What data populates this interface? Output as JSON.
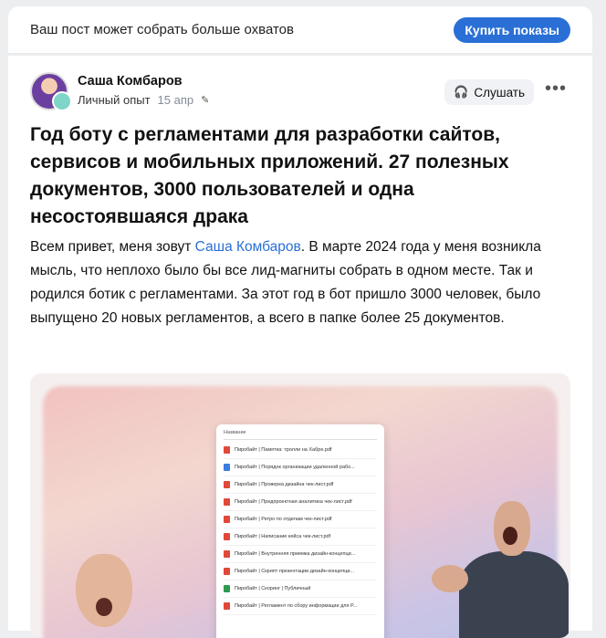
{
  "promo": {
    "text": "Ваш пост может собрать больше охватов",
    "button": "Купить показы"
  },
  "post": {
    "author": "Саша Комбаров",
    "category": "Личный опыт",
    "date": "15 апр",
    "listen_label": "Слушать",
    "title": "Год боту с регламентами для разработки сайтов, сервисов и мобильных приложений. 27 полезных документов, 3000 пользователей и одна несостоявшаяся драка",
    "body_pre": "Всем привет, меня зовут ",
    "body_link": "Саша Комбаров",
    "body_post": ". В марте 2024 года у меня возникла мысль, что неплохо было бы все лид-магниты собрать в одном месте. Так и родился ботик с регламентами. За этот год в бот пришло 3000 человек, было выпущено 20 новых регламентов, а всего в папке более 25 документов."
  },
  "image": {
    "header": "Название",
    "files": [
      {
        "type": "pdf",
        "name": "Пиробайт | Памятка: тролли на Хабре.pdf"
      },
      {
        "type": "doc",
        "name": "Пиробайт | Порядок организации удаленной рабо..."
      },
      {
        "type": "pdf",
        "name": "Пиробайт | Проверка дизайна чек-лист.pdf"
      },
      {
        "type": "pdf",
        "name": "Пиробайт | Предпроектная аналитика чек-лист.pdf"
      },
      {
        "type": "pdf",
        "name": "Пиробайт | Ретро по отделам чек-лист.pdf"
      },
      {
        "type": "pdf",
        "name": "Пиробайт | Написание кейса чек-лист.pdf"
      },
      {
        "type": "pdf",
        "name": "Пиробайт | Внутренняя приемка дизайн-концепци..."
      },
      {
        "type": "pdf",
        "name": "Пиробайт | Скрипт презентации дизайн-концепци..."
      },
      {
        "type": "xls",
        "name": "Пиробайт | Скоринг | Публичный"
      },
      {
        "type": "pdf",
        "name": "Пиробайт | Регламент по сбору информации для Р..."
      }
    ]
  },
  "colors": {
    "accent": "#2a6fd6",
    "background": "#edeef0"
  },
  "icons": {
    "listen": "headphones-icon",
    "more": "more-dots-icon",
    "edited": "pencil-icon"
  }
}
